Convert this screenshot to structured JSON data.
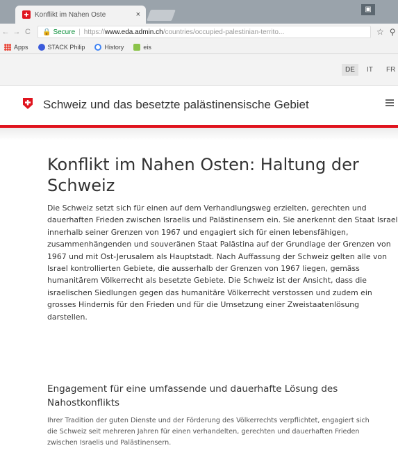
{
  "browser": {
    "tab": {
      "title": "Konflikt im Nahen Oste",
      "close_label": "×"
    },
    "window_button": "▣",
    "toolbar": {
      "back": "←",
      "forward": "→",
      "reload": "C",
      "lock": "🔒",
      "secure_label": "Secure",
      "url_scheme": "https://",
      "url_host": "www.eda.admin.ch",
      "url_path": "/countries/occupied-palestinian-territo...",
      "star": "☆"
    },
    "bookmarks": [
      {
        "label": "Apps",
        "color": "#e94335"
      },
      {
        "label": "STACK Philip",
        "color": "#3b5bdb"
      },
      {
        "label": "History",
        "color": "#4285f4"
      },
      {
        "label": "eis",
        "color": "#8bc34a"
      }
    ]
  },
  "languages": [
    "DE",
    "IT",
    "FR"
  ],
  "active_language": "DE",
  "site": {
    "title": "Schweiz und das besetzte palästinensische Gebiet",
    "brand_color": "#e0141e"
  },
  "article": {
    "title": "Konflikt im Nahen Osten: Haltung der Schweiz",
    "intro": "Die Schweiz setzt sich für einen auf dem Verhandlungsweg erzielten, gerechten und dauerhaften Frieden zwischen Israelis und Palästinensern ein. Sie anerkennt den Staat Israel innerhalb seiner Grenzen von 1967 und engagiert sich für einen lebensfähigen, zusammenhängenden und souveränen Staat Palästina auf der Grundlage der Grenzen von 1967 und mit Ost-Jerusalem als Hauptstadt. Nach Auffassung der Schweiz gelten alle von Israel kontrollierten Gebiete, die ausserhalb der Grenzen von 1967 liegen, gemäss humanitärem Völkerrecht als besetzte Gebiete. Die Schweiz ist der Ansicht, dass die israelischen Siedlungen gegen das humanitäre Völkerrecht verstossen und zudem ein grosses Hindernis für den Frieden und für die Umsetzung einer Zweistaatenlösung darstellen.",
    "section_heading": "Engagement für eine umfassende und dauerhafte Lösung des Nahostkonflikts",
    "section_text": "Ihrer Tradition der guten Dienste und der Förderung des Völkerrechts verpflichtet, engagiert sich die Schweiz seit mehreren Jahren für einen verhandelten, gerechten und dauerhaften Frieden zwischen Israelis und Palästinensern."
  }
}
